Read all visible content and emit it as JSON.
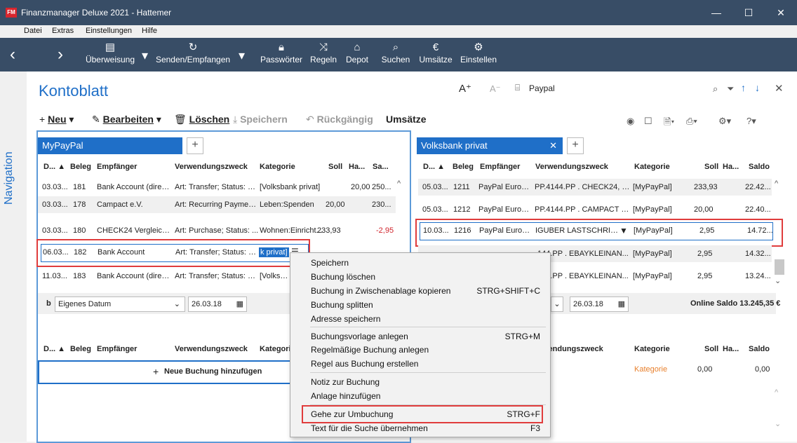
{
  "window": {
    "logo": "FM",
    "title": "Finanzmanager Deluxe 2021 - Hattemer",
    "minimize": "—",
    "maximize": "☐",
    "close": "✕"
  },
  "menu": [
    "Datei",
    "Extras",
    "Einstellungen",
    "Hilfe"
  ],
  "toolbar": {
    "ueberweisung": "Überweisung",
    "senden": "Senden/Empfangen",
    "passwoerter": "Passwörter",
    "regeln": "Regeln",
    "depot": "Depot",
    "suchen": "Suchen",
    "umsaetze": "Umsätze",
    "einstellen": "Einstellen"
  },
  "nav_label": "Navigation",
  "page_title": "Kontoblatt",
  "search_value": "Paypal",
  "actions": {
    "neu": "Neu",
    "bearbeiten": "Bearbeiten",
    "loeschen": "Löschen",
    "speichern": "Speichern",
    "rueckgaengig": "Rückgängig",
    "umsaetze": "Umsätze"
  },
  "left_pane": {
    "tab": "MyPayPal",
    "headers": [
      "D...",
      "Beleg",
      "Empfänger",
      "Verwendungszweck",
      "Kategorie",
      "Soll",
      "Ha...",
      "Sa..."
    ],
    "rows": [
      {
        "d": "03.03...",
        "beleg": "181",
        "empf": "Bank Account (direct...",
        "zweck": "Art: Transfer; Status: C...",
        "kat": "[Volksbank privat]",
        "soll": "",
        "haben": "20,00",
        "saldo": "250..."
      },
      {
        "d": "03.03...",
        "beleg": "178",
        "empf": "Campact e.V.",
        "zweck": "Art: Recurring Paymen...",
        "kat": "Leben:Spenden",
        "soll": "20,00",
        "haben": "",
        "saldo": "230..."
      },
      {
        "d": "03.03...",
        "beleg": "180",
        "empf": "CHECK24 Vergleichs...",
        "zweck": "Art: Purchase; Status: ...",
        "kat": "Wohnen:Einricht...",
        "soll": "233,93",
        "haben": "",
        "saldo": "-2,95"
      },
      {
        "d": "06.03...",
        "beleg": "182",
        "empf": "Bank Account",
        "zweck": "Art: Transfer; Status: C...",
        "kat": "k privat]",
        "soll": "",
        "haben": "",
        "saldo": ""
      },
      {
        "d": "11.03...",
        "beleg": "183",
        "empf": "Bank Account (direct...",
        "zweck": "Art: Transfer; Status: C...",
        "kat": "[Volksbar",
        "soll": "",
        "haben": "",
        "saldo": ""
      }
    ],
    "footer_prefix": "b",
    "footer_dropdown": "Eigenes Datum",
    "footer_date": "26.03.18",
    "bottom_headers": [
      "D...",
      "Beleg",
      "Empfänger",
      "Verwendungszweck",
      "Kategori"
    ],
    "new_booking": "Neue Buchung hinzufügen"
  },
  "right_pane": {
    "tab": "Volksbank privat",
    "headers": [
      "D...",
      "Beleg",
      "Empfänger",
      "Verwendungszweck",
      "Kategorie",
      "Soll",
      "Ha...",
      "Saldo"
    ],
    "rows": [
      {
        "d": "05.03...",
        "beleg": "1211",
        "empf": "PayPal Europe...",
        "zweck": "PP.4144.PP . CHECK24, Ihr ...",
        "kat": "[MyPayPal]",
        "soll": "233,93",
        "haben": "",
        "saldo": "22.42..."
      },
      {
        "d": "05.03...",
        "beleg": "1212",
        "empf": "PayPal Europe...",
        "zweck": "PP.4144.PP . CAMPACT E V...",
        "kat": "[MyPayPal]",
        "soll": "20,00",
        "haben": "",
        "saldo": "22.40..."
      },
      {
        "d": "10.03...",
        "beleg": "1216",
        "empf": "PayPal Europe...",
        "zweck": "IGUBER LASTSCHRIFT an",
        "kat": "[MyPayPal]",
        "soll": "2,95",
        "haben": "",
        "saldo": "14.72..."
      },
      {
        "d": "",
        "beleg": "",
        "empf": "",
        "zweck": "144.PP . EBAYKLEINAN...",
        "kat": "[MyPayPal]",
        "soll": "2,95",
        "haben": "",
        "saldo": "14.32..."
      },
      {
        "d": "",
        "beleg": "",
        "empf": "",
        "zweck": "144.PP . EBAYKLEINAN...",
        "kat": "[MyPayPal]",
        "soll": "2,95",
        "haben": "",
        "saldo": "13.24..."
      }
    ],
    "footer_date": "26.03.18",
    "online_saldo": "Online Saldo 13.245,35 €",
    "bottom_headers": [
      "wendungszweck",
      "Kategorie",
      "Soll",
      "Ha...",
      "Saldo"
    ],
    "bottom_row": {
      "kat": "Kategorie",
      "soll": "0,00",
      "saldo": "0,00"
    }
  },
  "context_menu": {
    "items": [
      {
        "label": "Speichern",
        "shortcut": ""
      },
      {
        "label": "Buchung löschen",
        "shortcut": ""
      },
      {
        "label": "Buchung in Zwischenablage kopieren",
        "shortcut": "STRG+SHIFT+C"
      },
      {
        "label": "Buchung splitten",
        "shortcut": ""
      },
      {
        "label": "Adresse speichern",
        "shortcut": ""
      },
      {
        "label": "Buchungsvorlage anlegen",
        "shortcut": "STRG+M"
      },
      {
        "label": "Regelmäßige Buchung anlegen",
        "shortcut": ""
      },
      {
        "label": "Regel aus Buchung erstellen",
        "shortcut": ""
      },
      {
        "label": "Notiz zur Buchung",
        "shortcut": ""
      },
      {
        "label": "Anlage hinzufügen",
        "shortcut": ""
      },
      {
        "label": "Gehe zur Umbuchung",
        "shortcut": "STRG+F"
      },
      {
        "label": "Text für die Suche übernehmen",
        "shortcut": "F3"
      }
    ]
  },
  "colors": {
    "titlebar": "#384d66",
    "accent": "#1f6fc8",
    "highlight_red": "#e03c3c",
    "negative": "#d0232b"
  }
}
